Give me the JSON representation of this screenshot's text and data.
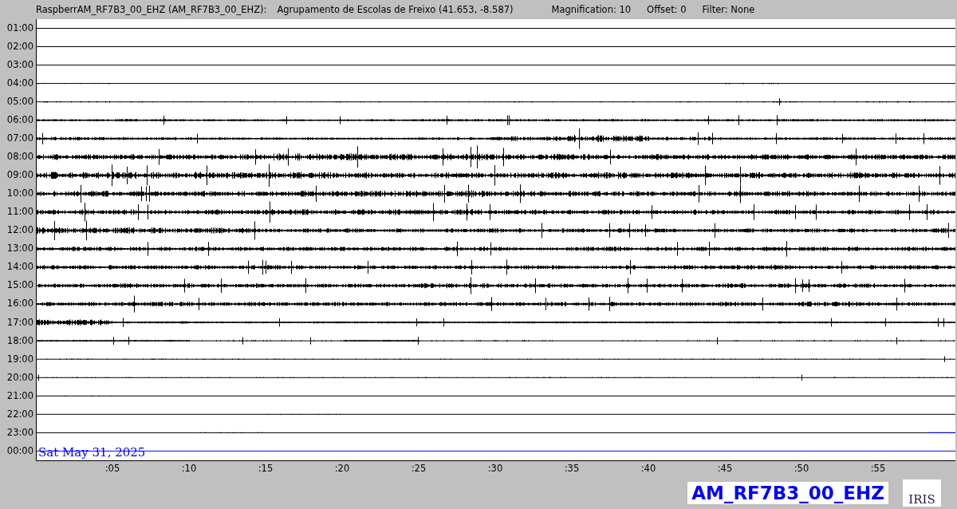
{
  "header": {
    "station": "RaspberrAM_RF7B3_00_EHZ (AM_RF7B3_00_EHZ):",
    "location": "Agrupamento de Escolas de Freixo (41.653, -8.587)",
    "magnification": "Magnification: 10",
    "offset": "Offset: 0",
    "filter": "Filter: None"
  },
  "rows": [
    {
      "label": "01:00"
    },
    {
      "label": "02:00"
    },
    {
      "label": "03:00"
    },
    {
      "label": "04:00"
    },
    {
      "label": "05:00"
    },
    {
      "label": "06:00"
    },
    {
      "label": "07:00"
    },
    {
      "label": "08:00"
    },
    {
      "label": "09:00"
    },
    {
      "label": "10:00"
    },
    {
      "label": "11:00"
    },
    {
      "label": "12:00"
    },
    {
      "label": "13:00"
    },
    {
      "label": "14:00"
    },
    {
      "label": "15:00"
    },
    {
      "label": "16:00"
    },
    {
      "label": "17:00"
    },
    {
      "label": "18:00"
    },
    {
      "label": "19:00"
    },
    {
      "label": "20:00"
    },
    {
      "label": "21:00"
    },
    {
      "label": "22:00"
    },
    {
      "label": "23:00"
    },
    {
      "label": "00:00"
    }
  ],
  "date_label": "Sat May 31, 2025",
  "x_ticks": [
    ":05",
    ":10",
    ":15",
    ":20",
    ":25",
    ":30",
    ":35",
    ":40",
    ":45",
    ":50",
    ":55"
  ],
  "station_code": "AM_RF7B3_00_EHZ",
  "logo_text": "IRIS"
}
